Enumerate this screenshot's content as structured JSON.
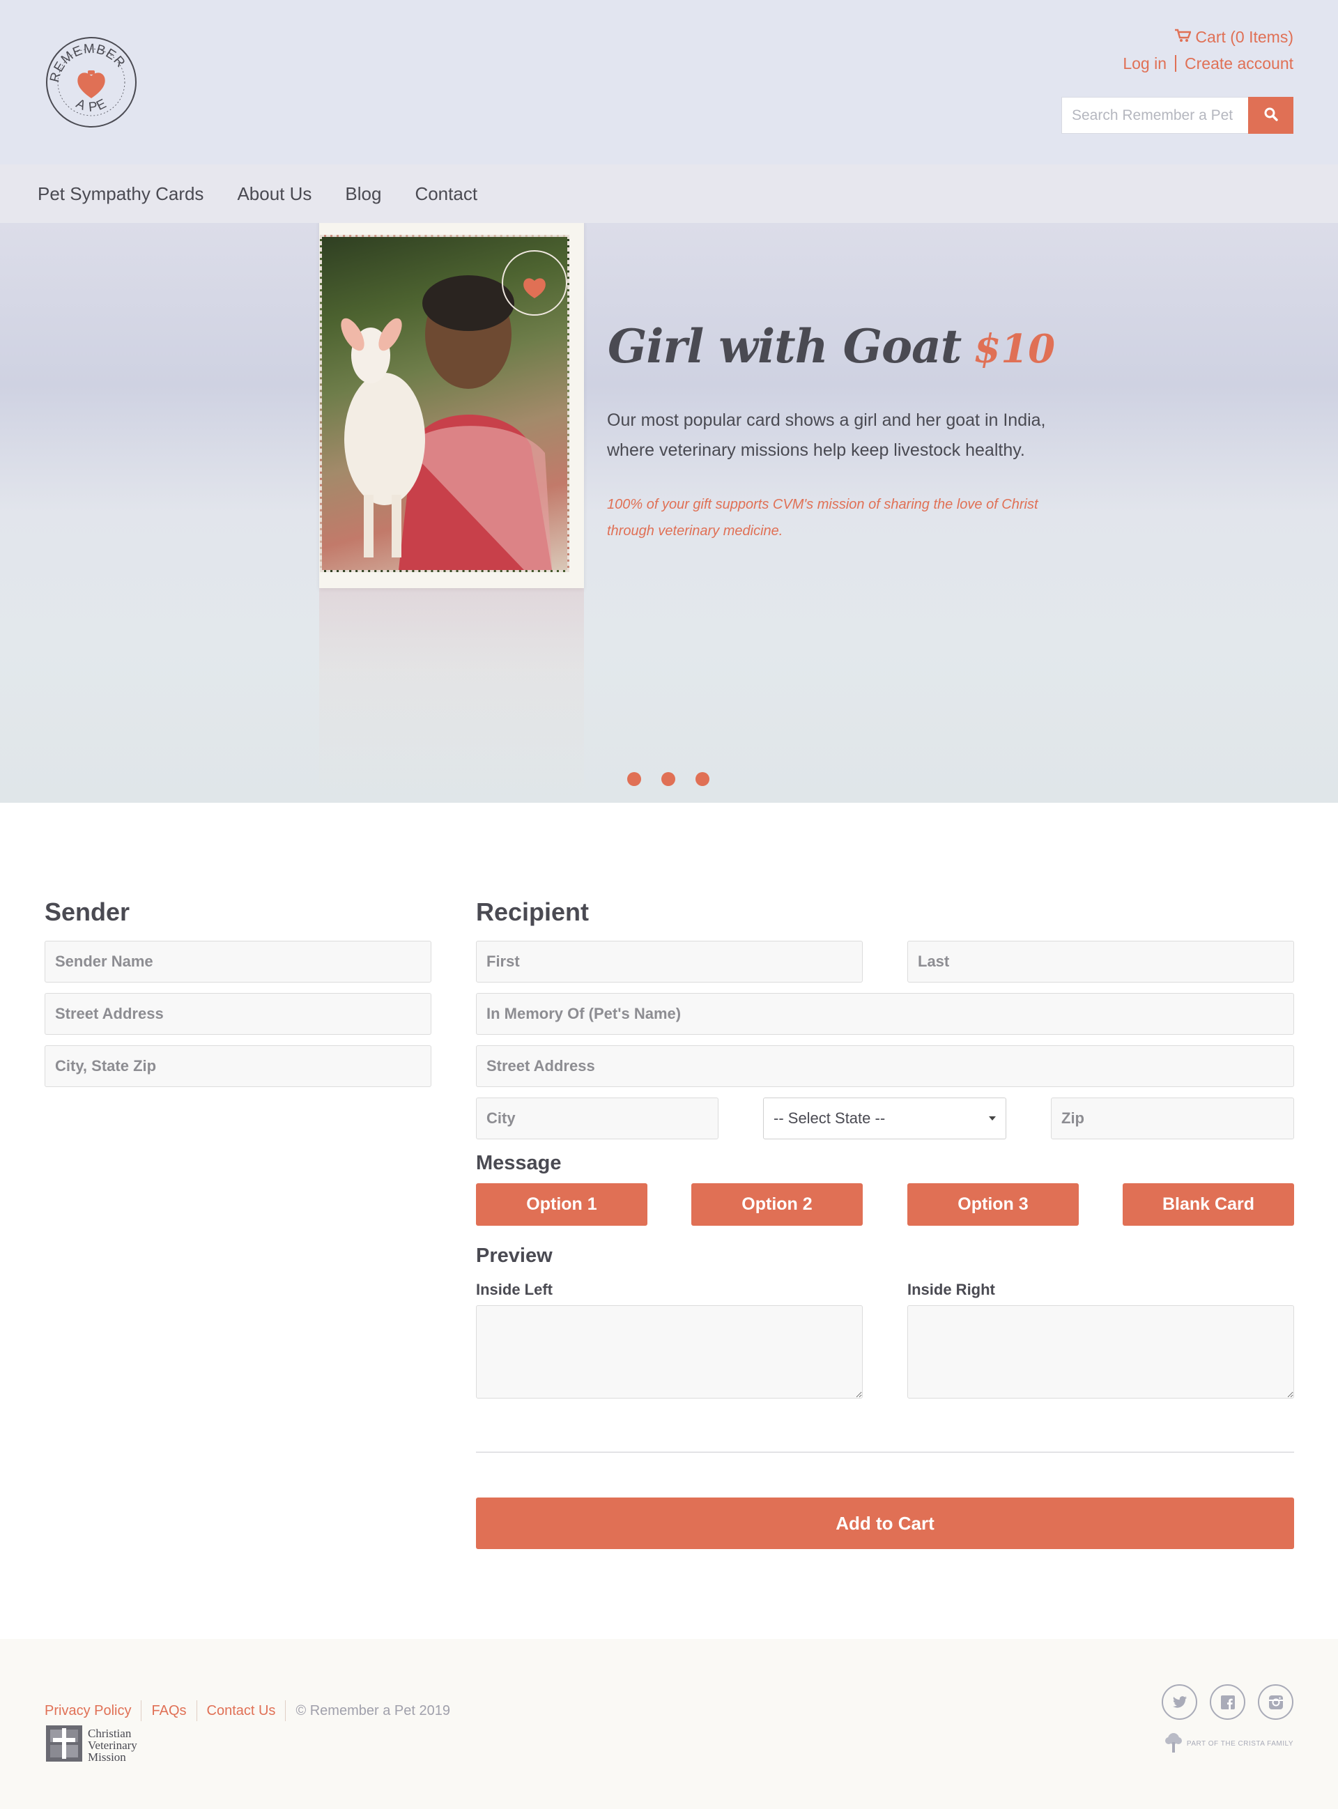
{
  "header": {
    "logo_text": "REMEMBER A PET",
    "cart_label": "Cart (0 Items)",
    "login_label": "Log in",
    "create_account_label": "Create account",
    "search_placeholder": "Search Remember a Pet"
  },
  "nav": {
    "items": [
      {
        "label": "Pet Sympathy Cards"
      },
      {
        "label": "About Us"
      },
      {
        "label": "Blog"
      },
      {
        "label": "Contact"
      }
    ]
  },
  "hero": {
    "title": "Girl with Goat",
    "price": "$10",
    "description": "Our most popular card shows a girl and her goat in India, where veterinary missions help keep livestock healthy.",
    "note": "100% of your gift supports CVM's mission of sharing the love of Christ through veterinary medicine.",
    "slide_count": 3
  },
  "sender": {
    "heading": "Sender",
    "name_placeholder": "Sender Name",
    "street_placeholder": "Street Address",
    "city_placeholder": "City, State Zip"
  },
  "recipient": {
    "heading": "Recipient",
    "first_placeholder": "First",
    "last_placeholder": "Last",
    "memory_placeholder": "In Memory Of (Pet's Name)",
    "street_placeholder": "Street Address",
    "city_placeholder": "City",
    "state_selected": "-- Select State --",
    "zip_placeholder": "Zip"
  },
  "message": {
    "heading": "Message",
    "options": [
      "Option 1",
      "Option 2",
      "Option 3",
      "Blank Card"
    ]
  },
  "preview": {
    "heading": "Preview",
    "inside_left_label": "Inside Left",
    "inside_right_label": "Inside Right"
  },
  "add_to_cart_label": "Add to Cart",
  "footer": {
    "links": [
      "Privacy Policy",
      "FAQs",
      "Contact Us"
    ],
    "copyright": "© Remember a Pet 2019",
    "cvm_lines": [
      "Christian",
      "Veterinary",
      "Mission"
    ],
    "crista_text": "PART OF THE CRISTA FAMILY",
    "social": [
      "twitter-icon",
      "facebook-icon",
      "instagram-icon"
    ]
  },
  "colors": {
    "accent": "#e07055",
    "header_bg": "#e2e5f0",
    "text": "#4a4a52",
    "footer_bg": "#faf9f5"
  }
}
